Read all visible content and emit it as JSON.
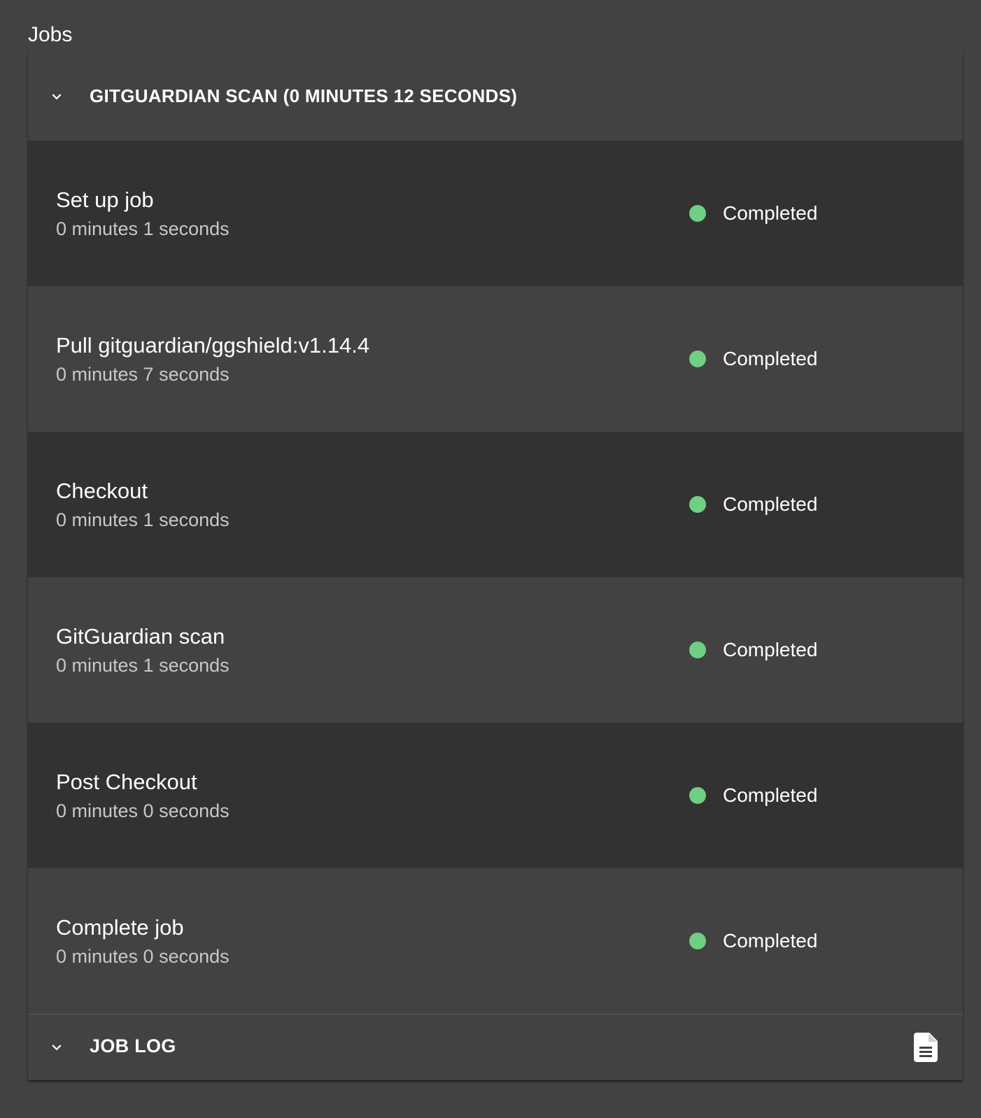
{
  "page": {
    "title": "Jobs"
  },
  "job": {
    "header": "GITGUARDIAN SCAN (0 MINUTES 12 SECONDS)",
    "expand_icon": "chevron-down-icon",
    "steps": [
      {
        "name": "Set up job",
        "duration": "0 minutes 1 seconds",
        "status": "Completed"
      },
      {
        "name": "Pull gitguardian/ggshield:v1.14.4",
        "duration": "0 minutes 7 seconds",
        "status": "Completed"
      },
      {
        "name": "Checkout",
        "duration": "0 minutes 1 seconds",
        "status": "Completed"
      },
      {
        "name": "GitGuardian scan",
        "duration": "0 minutes 1 seconds",
        "status": "Completed"
      },
      {
        "name": "Post Checkout",
        "duration": "0 minutes 0 seconds",
        "status": "Completed"
      },
      {
        "name": "Complete job",
        "duration": "0 minutes 0 seconds",
        "status": "Completed"
      }
    ]
  },
  "job_log": {
    "label": "JOB LOG",
    "expand_icon": "chevron-down-icon",
    "action_icon": "document-icon"
  },
  "colors": {
    "background": "#424242",
    "row_dark": "#323232",
    "status_completed": "#6fcf83",
    "secondary_text": "#c8c8c8"
  }
}
